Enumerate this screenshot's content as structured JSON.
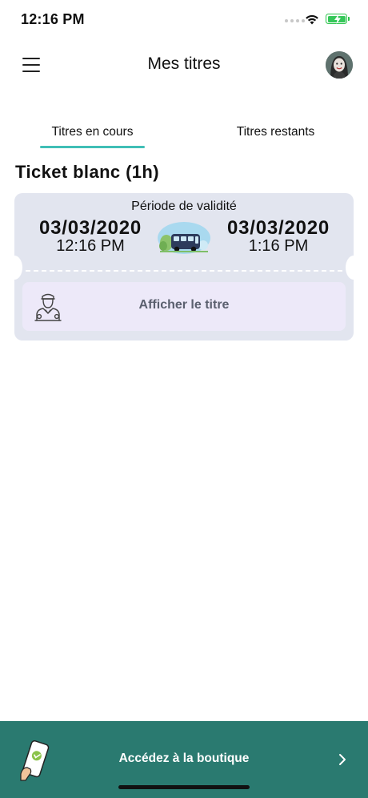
{
  "status_bar": {
    "time": "12:16 PM",
    "icons": [
      "signal-dots-icon",
      "wifi-icon",
      "battery-charging-icon"
    ],
    "battery_color": "#35c759"
  },
  "header": {
    "title": "Mes titres",
    "menu_icon": "hamburger-menu-icon",
    "avatar_icon": "user-avatar"
  },
  "tabs": [
    {
      "label": "Titres en cours",
      "active": true
    },
    {
      "label": "Titres restants",
      "active": false
    }
  ],
  "ticket": {
    "title": "Ticket blanc (1h)",
    "validity_label": "Période de validité",
    "start_date": "03/03/2020",
    "start_time": "12:16 PM",
    "end_date": "03/03/2020",
    "end_time": "1:16 PM",
    "illustration_icon": "bus-icon",
    "show_button_label": "Afficher le titre",
    "show_button_icon": "driver-icon"
  },
  "shop": {
    "label": "Accédez à la boutique",
    "icon": "phone-ticket-icon",
    "chevron_icon": "chevron-right-icon"
  },
  "colors": {
    "accent": "#40bfb6",
    "card_bg": "#e2e5ef",
    "button_bg": "#ede9f9",
    "shop_bar": "#2a7a70"
  }
}
